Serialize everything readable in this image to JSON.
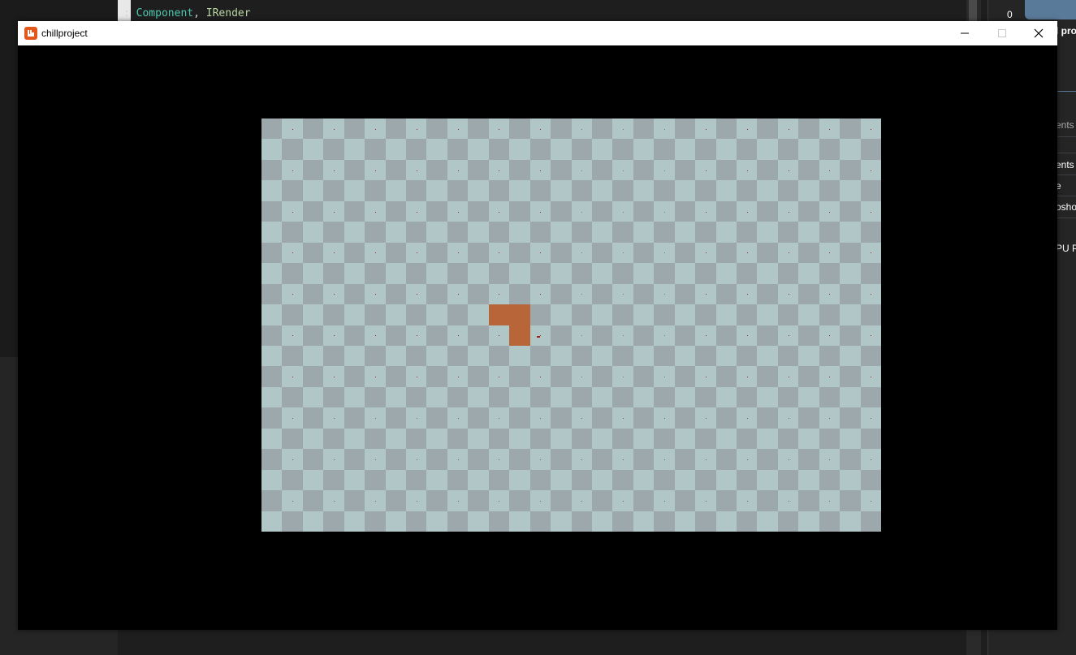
{
  "ide": {
    "code_line": {
      "prefix": ": ",
      "base_class": "Component",
      "separator": ", ",
      "interface": "IRender"
    },
    "panel_counter": "0",
    "panel_labels": [
      "l pro",
      "ents",
      "ents (",
      "e",
      "osho",
      "PU P"
    ]
  },
  "window": {
    "title": "chillproject",
    "buttons": [
      "minimize",
      "maximize",
      "close"
    ]
  },
  "game": {
    "grid": {
      "cols": 30,
      "rows": 20
    },
    "tile_colors": {
      "dark": "#9ca8ac",
      "light": "#b1c6c6"
    },
    "marker_colors": {
      "red": "#a02020",
      "gray": "#6f7f80",
      "green": "#5a6f5a"
    },
    "player": {
      "color": "#e08a48",
      "shape": "L-shaped brick block"
    }
  },
  "colors": {
    "accent": "#e4571b",
    "window_background": "#000000",
    "titlebar": "#ffffff"
  }
}
